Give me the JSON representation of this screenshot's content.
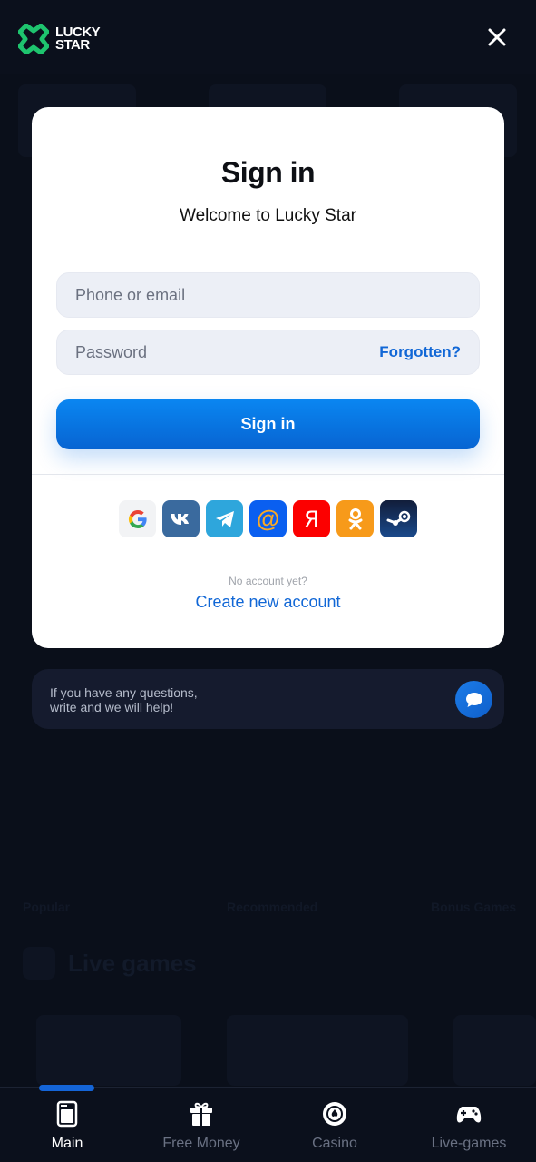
{
  "header": {
    "logo_line1": "LUCKY",
    "logo_line2": "STAR"
  },
  "signin_card": {
    "title": "Sign in",
    "subtitle": "Welcome to Lucky Star",
    "phone_placeholder": "Phone or email",
    "password_placeholder": "Password",
    "forgot_label": "Forgotten?",
    "submit_label": "Sign in",
    "social_providers": [
      {
        "name": "Google",
        "icon": "google-icon",
        "bg": "#f2f3f5"
      },
      {
        "name": "VK",
        "icon": "vk-icon",
        "bg": "#3a6a9e"
      },
      {
        "name": "Telegram",
        "icon": "telegram-icon",
        "bg": "#2ea6dc"
      },
      {
        "name": "Mail.ru",
        "icon": "mailru-icon",
        "bg": "#0a5ff0"
      },
      {
        "name": "Yandex",
        "icon": "yandex-icon",
        "bg": "#fc0000"
      },
      {
        "name": "Odnoklassniki",
        "icon": "ok-icon",
        "bg": "#f79a1a"
      },
      {
        "name": "Steam",
        "icon": "steam-icon",
        "bg": "#14294f"
      }
    ],
    "no_account_text": "No account yet?",
    "create_account_label": "Create new account"
  },
  "help": {
    "line1": "If you have any questions,",
    "line2": "write and we will help!"
  },
  "background": {
    "tabs": [
      "Popular",
      "Recommended",
      "Bonus Games"
    ],
    "section_title": "Live games"
  },
  "bottom_nav": {
    "items": [
      {
        "label": "Main",
        "icon": "main-icon",
        "active": true
      },
      {
        "label": "Free Money",
        "icon": "gift-icon",
        "active": false
      },
      {
        "label": "Casino",
        "icon": "casino-chip-icon",
        "active": false
      },
      {
        "label": "Live-games",
        "icon": "gamepad-icon",
        "active": false
      }
    ]
  },
  "colors": {
    "accent": "#1167d6",
    "brand_green": "#1ec46e",
    "background": "#0a0f1a"
  }
}
